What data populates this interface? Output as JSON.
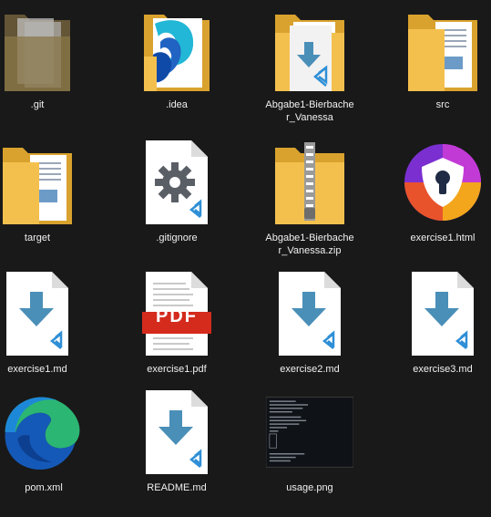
{
  "files": [
    {
      "label": ".git",
      "icon": "hidden-folder-icon"
    },
    {
      "label": ".idea",
      "icon": "intellij-folder-icon"
    },
    {
      "label": "Abgabe1-Bierbacher_Vanessa",
      "label_lines": [
        "Abgabe1-Bierbache",
        "r_Vanessa"
      ],
      "icon": "folder-with-vscode-file-icon"
    },
    {
      "label": "src",
      "icon": "folder-icon"
    },
    {
      "label": "target",
      "icon": "folder-icon"
    },
    {
      "label": ".gitignore",
      "icon": "gitignore-file-icon"
    },
    {
      "label": "Abgabe1-Bierbacher_Vanessa.zip",
      "label_lines": [
        "Abgabe1-Bierbache",
        "r_Vanessa.zip"
      ],
      "icon": "zip-folder-icon"
    },
    {
      "label": "exercise1.html",
      "icon": "avast-browser-icon"
    },
    {
      "label": "exercise1.md",
      "icon": "vscode-markdown-file-icon"
    },
    {
      "label": "exercise1.pdf",
      "icon": "pdf-file-icon"
    },
    {
      "label": "exercise2.md",
      "icon": "vscode-markdown-file-icon"
    },
    {
      "label": "exercise3.md",
      "icon": "vscode-markdown-file-icon"
    },
    {
      "label": "pom.xml",
      "icon": "edge-browser-icon"
    },
    {
      "label": "README.md",
      "icon": "vscode-markdown-file-icon"
    },
    {
      "label": "usage.png",
      "icon": "terminal-screenshot-thumbnail"
    }
  ],
  "icon_text": {
    "pdf_badge": "PDF"
  },
  "colors": {
    "background": "#191919",
    "folder": "#f4c04d",
    "folder_dark": "#d9a22e",
    "vscode_blue": "#2f8fd6",
    "download_arrow": "#4a8fb8",
    "pdf_red": "#d42b1d"
  }
}
